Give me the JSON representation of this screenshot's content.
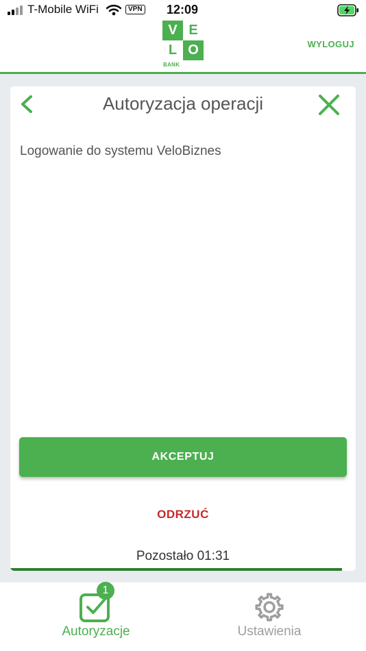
{
  "status_bar": {
    "carrier": "T-Mobile WiFi",
    "vpn": "VPN",
    "time": "12:09"
  },
  "header": {
    "logo": {
      "letters": [
        "V",
        "E",
        "L",
        "O"
      ],
      "subtitle": "BANK"
    },
    "logout_label": "WYLOGUJ"
  },
  "card": {
    "title": "Autoryzacja operacji",
    "description": "Logowanie do systemu VeloBiznes",
    "accept_label": "AKCEPTUJ",
    "reject_label": "ODRZUĆ",
    "remaining_text": "Pozostało 01:31",
    "time_progress_fraction": 0.96
  },
  "tabbar": {
    "tabs": [
      {
        "label": "Autoryzacje",
        "badge": "1",
        "icon": "check-square-icon",
        "active": true
      },
      {
        "label": "Ustawienia",
        "icon": "gear-icon",
        "active": false
      }
    ]
  },
  "colors": {
    "brand_green": "#4caf50",
    "reject_red": "#c62828",
    "progress_green": "#2e7d32",
    "background": "#e8ecef",
    "inactive_grey": "#9e9e9e"
  }
}
